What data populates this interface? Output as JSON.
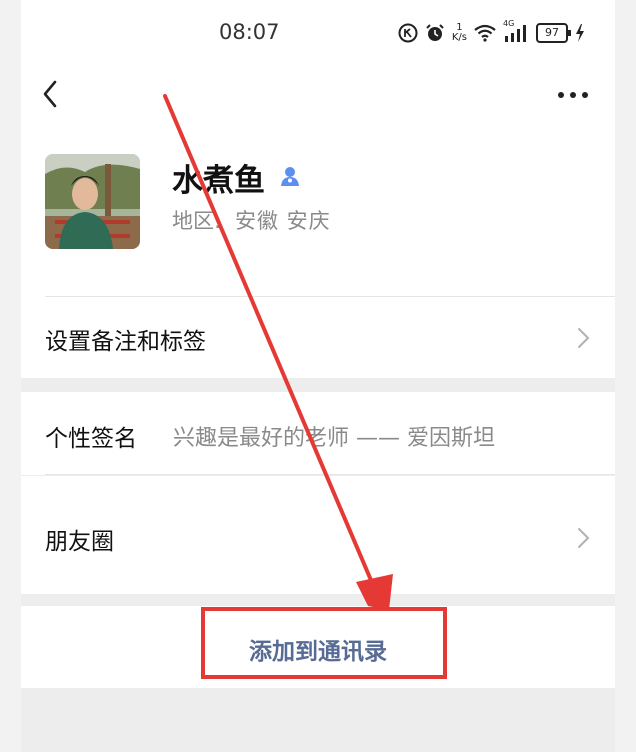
{
  "status_bar": {
    "time": "08:07",
    "net_speed_value": "1",
    "net_speed_unit": "K/s",
    "network_type": "4G",
    "battery": "97",
    "icons": [
      "hd-icon",
      "alarm-icon",
      "wifi-icon",
      "signal-icon",
      "battery-icon",
      "charging-icon"
    ]
  },
  "nav": {
    "back_icon": "chevron-left-icon",
    "more_icon": "more-dots-icon"
  },
  "profile": {
    "name": "水煮鱼",
    "region_label": "地区:",
    "region_value": "安徽  安庆"
  },
  "rows": {
    "remark_label": "设置备注和标签",
    "signature_label": "个性签名",
    "signature_value": "兴趣是最好的老师 —— 爱因斯坦",
    "moments_label": "朋友圈"
  },
  "actions": {
    "add_contact_label": "添加到通讯录"
  },
  "annotation": {
    "color": "#e53935"
  },
  "colors": {
    "link_blue": "#576b95",
    "verify_blue": "#5b8ff0",
    "background": "#ededed"
  }
}
